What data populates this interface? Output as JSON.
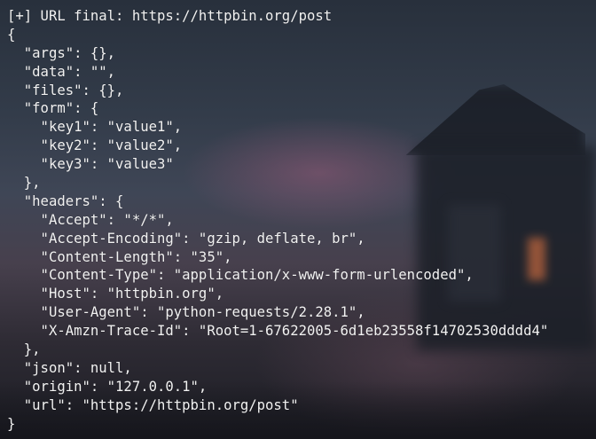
{
  "terminal": {
    "lines": [
      "[+] URL final: https://httpbin.org/post",
      "{",
      "  \"args\": {},",
      "  \"data\": \"\",",
      "  \"files\": {},",
      "  \"form\": {",
      "    \"key1\": \"value1\",",
      "    \"key2\": \"value2\",",
      "    \"key3\": \"value3\"",
      "  },",
      "  \"headers\": {",
      "    \"Accept\": \"*/*\",",
      "    \"Accept-Encoding\": \"gzip, deflate, br\",",
      "    \"Content-Length\": \"35\",",
      "    \"Content-Type\": \"application/x-www-form-urlencoded\",",
      "    \"Host\": \"httpbin.org\",",
      "    \"User-Agent\": \"python-requests/2.28.1\",",
      "    \"X-Amzn-Trace-Id\": \"Root=1-67622005-6d1eb23558f14702530dddd4\"",
      "  },",
      "  \"json\": null,",
      "  \"origin\": \"127.0.0.1\",",
      "  \"url\": \"https://httpbin.org/post\"",
      "}"
    ]
  },
  "colors": {
    "text": "#f2f2f2",
    "background": "#333c4a"
  }
}
